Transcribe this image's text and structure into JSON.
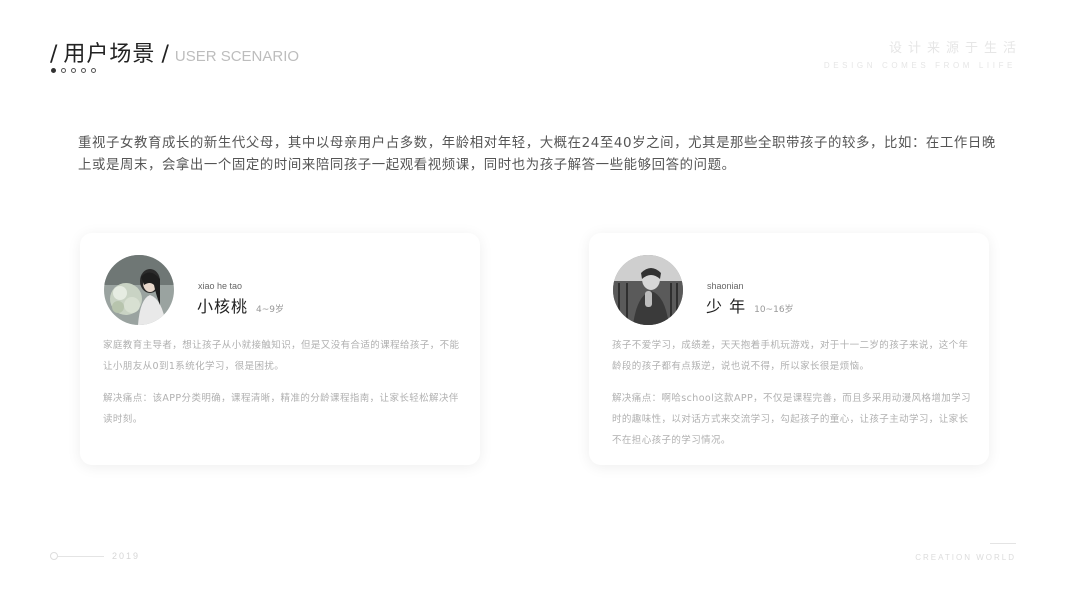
{
  "header": {
    "title_cn": "用户场景",
    "slash": "/",
    "title_en": "USER SCENARIO",
    "slogan_cn": "设计来源于生活",
    "slogan_en": "DESIGN COMES FROM LIIFE"
  },
  "intro": "重视子女教育成长的新生代父母，其中以母亲用户占多数，年龄相对年轻，大概在24至40岁之间，尤其是那些全职带孩子的较多，比如：在工作日晚上或是周末，会拿出一个固定的时间来陪同孩子一起观看视频课，同时也为孩子解答一些能够回答的问题。",
  "personas": [
    {
      "name_en": "xiao he tao",
      "name_cn": "小核桃",
      "age": "4~9岁",
      "desc1": "家庭教育主导者，想让孩子从小就接触知识，但是又没有合适的课程给孩子，不能让小朋友从0到1系统化学习，很是困扰。",
      "desc2": "解决痛点：该APP分类明确，课程清晰，精准的分龄课程指南，让家长轻松解决伴读时刻。"
    },
    {
      "name_en": "shaonian",
      "name_cn": "少 年",
      "age": "10~16岁",
      "desc1": "孩子不爱学习，成绩差，天天抱着手机玩游戏，对于十一二岁的孩子来说，这个年龄段的孩子都有点叛逆，说也说不得，所以家长很是烦恼。",
      "desc2": "解决痛点：啊哈school这款APP，不仅是课程完善，而且多采用动漫风格增加学习时的趣味性，以对话方式来交流学习，勾起孩子的童心，让孩子主动学习，让家长不在担心孩子的学习情况。"
    }
  ],
  "footer": {
    "year": "2019",
    "right": "CREATION WORLD"
  }
}
